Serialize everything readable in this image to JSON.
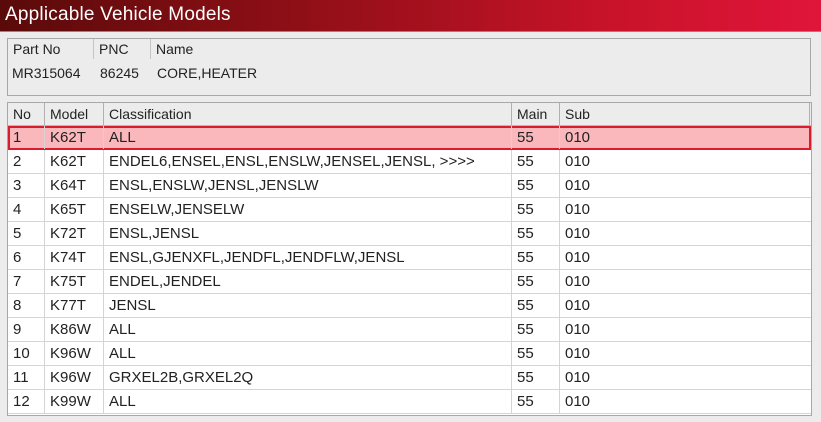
{
  "window": {
    "title": "Applicable Vehicle Models"
  },
  "part": {
    "headers": {
      "part_no": "Part No",
      "pnc": "PNC",
      "name": "Name"
    },
    "part_no": "MR315064",
    "pnc": "86245",
    "name": "CORE,HEATER"
  },
  "table": {
    "headers": {
      "no": "No",
      "model": "Model",
      "classification": "Classification",
      "main": "Main",
      "sub": "Sub"
    },
    "selected_index": 0,
    "rows": [
      {
        "no": "1",
        "model": "K62T",
        "classification": "ALL",
        "main": "55",
        "sub": "010"
      },
      {
        "no": "2",
        "model": "K62T",
        "classification": "ENDEL6,ENSEL,ENSL,ENSLW,JENSEL,JENSL,  >>>>",
        "main": "55",
        "sub": "010"
      },
      {
        "no": "3",
        "model": "K64T",
        "classification": "ENSL,ENSLW,JENSL,JENSLW",
        "main": "55",
        "sub": "010"
      },
      {
        "no": "4",
        "model": "K65T",
        "classification": "ENSELW,JENSELW",
        "main": "55",
        "sub": "010"
      },
      {
        "no": "5",
        "model": "K72T",
        "classification": "ENSL,JENSL",
        "main": "55",
        "sub": "010"
      },
      {
        "no": "6",
        "model": "K74T",
        "classification": "ENSL,GJENXFL,JENDFL,JENDFLW,JENSL",
        "main": "55",
        "sub": "010"
      },
      {
        "no": "7",
        "model": "K75T",
        "classification": "ENDEL,JENDEL",
        "main": "55",
        "sub": "010"
      },
      {
        "no": "8",
        "model": "K77T",
        "classification": "JENSL",
        "main": "55",
        "sub": "010"
      },
      {
        "no": "9",
        "model": "K86W",
        "classification": "ALL",
        "main": "55",
        "sub": "010"
      },
      {
        "no": "10",
        "model": "K96W",
        "classification": "ALL",
        "main": "55",
        "sub": "010"
      },
      {
        "no": "11",
        "model": "K96W",
        "classification": "GRXEL2B,GRXEL2Q",
        "main": "55",
        "sub": "010"
      },
      {
        "no": "12",
        "model": "K99W",
        "classification": "ALL",
        "main": "55",
        "sub": "010"
      }
    ]
  },
  "colors": {
    "title_gradient_start": "#5a0a0a",
    "title_gradient_end": "#e0153a",
    "selected_row_fill": "#fbb8bc",
    "selected_row_border": "#d81d2e"
  }
}
